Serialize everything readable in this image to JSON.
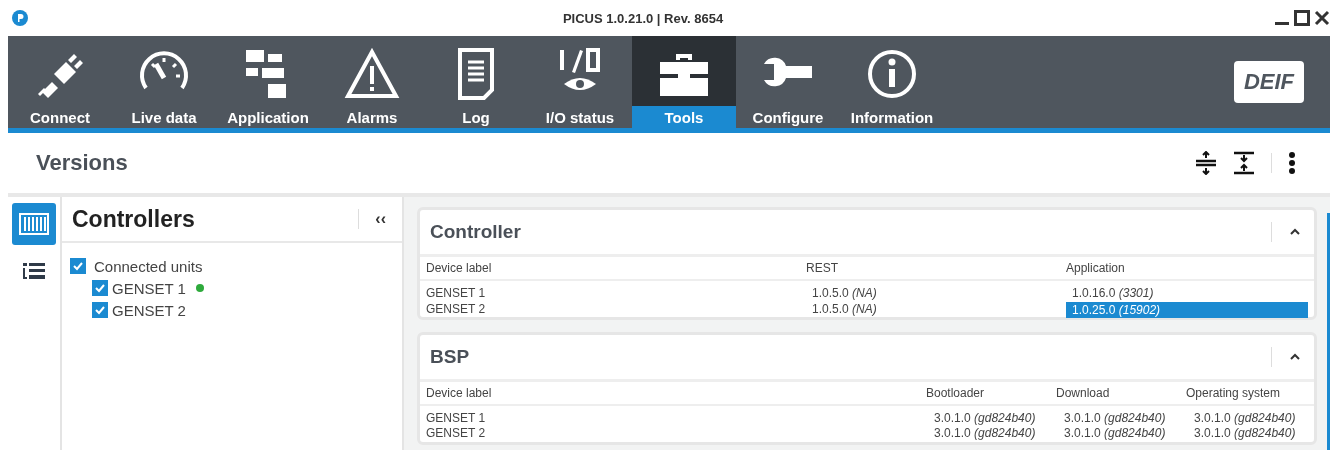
{
  "window": {
    "title": "PICUS 1.0.21.0 | Rev. 8654"
  },
  "nav": [
    {
      "label": "Connect",
      "selected": false
    },
    {
      "label": "Live data",
      "selected": false
    },
    {
      "label": "Application",
      "selected": false
    },
    {
      "label": "Alarms",
      "selected": false
    },
    {
      "label": "Log",
      "selected": false
    },
    {
      "label": "I/O status",
      "selected": false
    },
    {
      "label": "Tools",
      "selected": true
    },
    {
      "label": "Configure",
      "selected": false
    },
    {
      "label": "Information",
      "selected": false
    }
  ],
  "logo": "DEIF",
  "page_title": "Versions",
  "rail": [
    {
      "selected": true
    },
    {
      "selected": false
    }
  ],
  "tree": {
    "title": "Controllers",
    "collapse": "‹‹",
    "items": [
      {
        "label": "Connected units",
        "checked": true,
        "children": [
          {
            "label": "GENSET 1",
            "checked": true,
            "color": "#2eaa3c"
          },
          {
            "label": "GENSET 2",
            "checked": true
          }
        ]
      }
    ]
  },
  "cards": [
    {
      "title": "Controller",
      "columns": [
        "Device label",
        "REST",
        "Application"
      ],
      "rows": [
        [
          {
            "text": "GENSET 1",
            "selected": false
          },
          {
            "text": "1.0.5.0 *(NA)*",
            "selected": false
          },
          {
            "text": "1.0.16.0 *(3301)*",
            "selected": false
          }
        ],
        [
          {
            "text": "GENSET 2",
            "selected": false
          },
          {
            "text": "1.0.5.0 *(NA)*",
            "selected": false
          },
          {
            "text": "1.0.25.0 *(15902)*",
            "selected": true
          }
        ]
      ]
    },
    {
      "title": "BSP",
      "columns": [
        "Device label",
        "Bootloader",
        "Download",
        "Operating system"
      ],
      "rows": [
        [
          {
            "text": "GENSET 1",
            "selected": false
          },
          {
            "text": "3.0.1.0 *(gd824b40)*",
            "selected": false
          },
          {
            "text": "3.0.1.0 *(gd824b40)*",
            "selected": false
          },
          {
            "text": "3.0.1.0 *(gd824b40)*",
            "selected": false
          }
        ],
        [
          {
            "text": "GENSET 2",
            "selected": false
          },
          {
            "text": "3.0.1.0 *(gd824b40)*",
            "selected": false
          },
          {
            "text": "3.0.1.0 *(gd824b40)*",
            "selected": false
          },
          {
            "text": "3.0.1.0 *(gd824b40)*",
            "selected": false
          }
        ]
      ]
    }
  ]
}
